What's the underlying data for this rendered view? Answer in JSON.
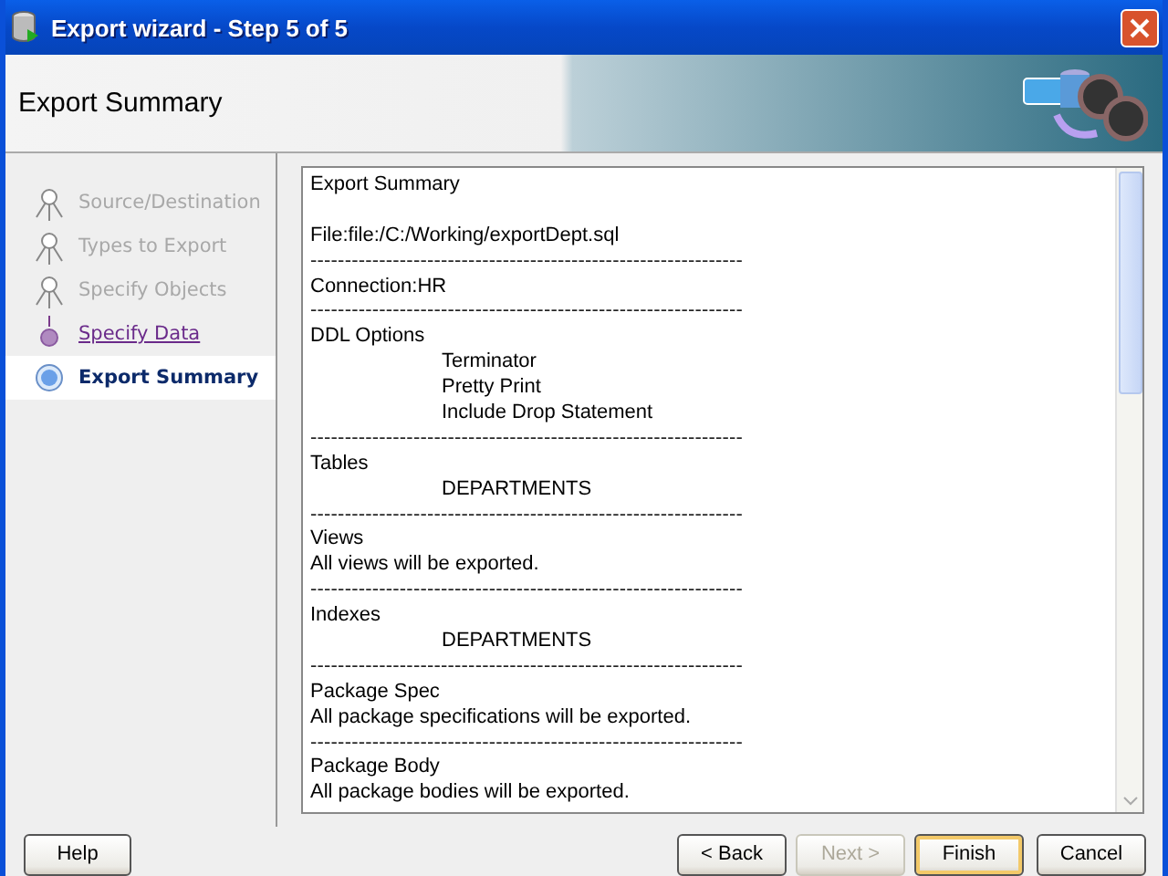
{
  "window": {
    "title": "Export wizard - Step 5 of 5"
  },
  "header": {
    "title": "Export Summary"
  },
  "steps": [
    {
      "label": "Source/Destination",
      "kind": "done",
      "selected": false
    },
    {
      "label": "Types to Export",
      "kind": "done",
      "selected": false
    },
    {
      "label": "Specify Objects",
      "kind": "done",
      "selected": false
    },
    {
      "label": "Specify Data",
      "kind": "link",
      "selected": false
    },
    {
      "label": "Export Summary",
      "kind": "current",
      "selected": true
    }
  ],
  "summary": [
    {
      "kind": "text",
      "text": "Export Summary"
    },
    {
      "kind": "blank"
    },
    {
      "kind": "text",
      "text": "File:file:/C:/Working/exportDept.sql"
    },
    {
      "kind": "rule",
      "text": "---------------------------------------------------------------"
    },
    {
      "kind": "text",
      "text": "Connection:HR"
    },
    {
      "kind": "rule",
      "text": "---------------------------------------------------------------"
    },
    {
      "kind": "text",
      "text": "DDL Options"
    },
    {
      "kind": "indent",
      "text": "Terminator"
    },
    {
      "kind": "indent",
      "text": "Pretty Print"
    },
    {
      "kind": "indent",
      "text": "Include Drop Statement"
    },
    {
      "kind": "rule",
      "text": "---------------------------------------------------------------"
    },
    {
      "kind": "text",
      "text": "Tables"
    },
    {
      "kind": "indent",
      "text": "DEPARTMENTS"
    },
    {
      "kind": "rule",
      "text": "---------------------------------------------------------------"
    },
    {
      "kind": "text",
      "text": "Views"
    },
    {
      "kind": "text",
      "text": "All views will be exported."
    },
    {
      "kind": "rule",
      "text": "---------------------------------------------------------------"
    },
    {
      "kind": "text",
      "text": "Indexes"
    },
    {
      "kind": "indent",
      "text": "DEPARTMENTS"
    },
    {
      "kind": "rule",
      "text": "---------------------------------------------------------------"
    },
    {
      "kind": "text",
      "text": "Package Spec"
    },
    {
      "kind": "text",
      "text": "All package specifications will be exported."
    },
    {
      "kind": "rule",
      "text": "---------------------------------------------------------------"
    },
    {
      "kind": "text",
      "text": "Package Body"
    },
    {
      "kind": "text",
      "text": "All package bodies will be exported."
    }
  ],
  "buttons": [
    {
      "label": "Help",
      "kind": "help",
      "disabled": false,
      "default": false
    },
    {
      "label": "< Back",
      "kind": "nav",
      "disabled": false,
      "default": false
    },
    {
      "label": "Next >",
      "kind": "nav",
      "disabled": true,
      "default": false
    },
    {
      "label": "Finish",
      "kind": "nav",
      "disabled": false,
      "default": true
    },
    {
      "label": "Cancel",
      "kind": "cancel",
      "disabled": false,
      "default": false
    }
  ]
}
